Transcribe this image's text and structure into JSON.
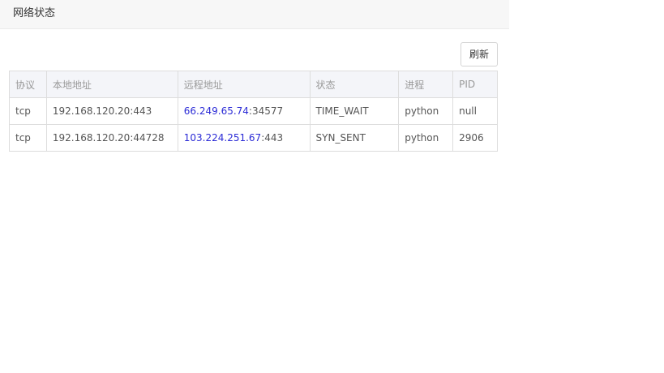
{
  "panel": {
    "title": "网络状态"
  },
  "toolbar": {
    "refresh_label": "刷新"
  },
  "table": {
    "columns": [
      "协议",
      "本地地址",
      "远程地址",
      "状态",
      "进程",
      "PID"
    ],
    "rows": [
      {
        "protocol": "tcp",
        "local": "192.168.120.20:443",
        "remote_ip": "66.249.65.74",
        "remote_port": ":34577",
        "state": "TIME_WAIT",
        "process": "python",
        "pid": "null"
      },
      {
        "protocol": "tcp",
        "local": "192.168.120.20:44728",
        "remote_ip": "103.224.251.67",
        "remote_port": ":443",
        "state": "SYN_SENT",
        "process": "python",
        "pid": "2906"
      }
    ]
  },
  "colors": {
    "link": "#2b2bd6",
    "header_bg": "#f4f5f9"
  }
}
